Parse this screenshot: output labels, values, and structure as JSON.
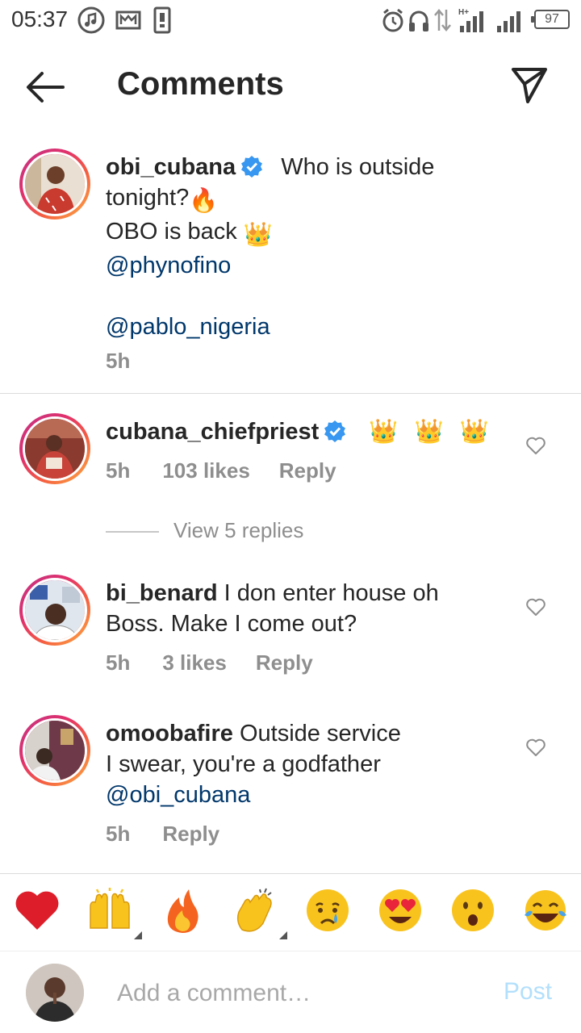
{
  "status_bar": {
    "time": "05:37",
    "battery": "97",
    "icons": [
      "music-icon",
      "mail-icon",
      "phone-icon",
      "alarm-icon",
      "headphones-icon",
      "data-transfer-icon",
      "signal-hplus-icon",
      "signal-icon",
      "battery-icon"
    ]
  },
  "header": {
    "title": "Comments",
    "back_icon": "back-arrow-icon",
    "share_icon": "send-icon"
  },
  "caption": {
    "username": "obi_cubana",
    "verified": true,
    "line1": "Who is outside",
    "line2": "tonight?",
    "line2_emoji": "🔥",
    "line3": "OBO is back",
    "line3_emoji": "👑",
    "mention1": "@phynofino",
    "mention2": "@pablo_nigeria",
    "time": "5h"
  },
  "comments": [
    {
      "username": "cubana_chiefpriest",
      "verified": true,
      "emojis": "👑 👑 👑",
      "time": "5h",
      "likes": "103 likes",
      "reply": "Reply",
      "view_replies": "View 5 replies"
    },
    {
      "username": "bi_benard",
      "text1": "I don enter house oh",
      "text2": "Boss. Make I come out?",
      "time": "5h",
      "likes": "3 likes",
      "reply": "Reply"
    },
    {
      "username": "omoobafire",
      "text1": "Outside service",
      "text2": "I swear, you're a godfather",
      "mention": "@obi_cubana",
      "time": "5h",
      "reply": "Reply"
    }
  ],
  "emoji_bar": [
    "❤️",
    "🙌",
    "🔥",
    "👏",
    "😢",
    "😍",
    "😮",
    "😂"
  ],
  "composer": {
    "placeholder": "Add a comment…",
    "post_label": "Post"
  },
  "colors": {
    "mention": "#00376b",
    "verified": "#3897f0",
    "meta": "#8e8e8e",
    "post_disabled": "#b2dffc"
  }
}
